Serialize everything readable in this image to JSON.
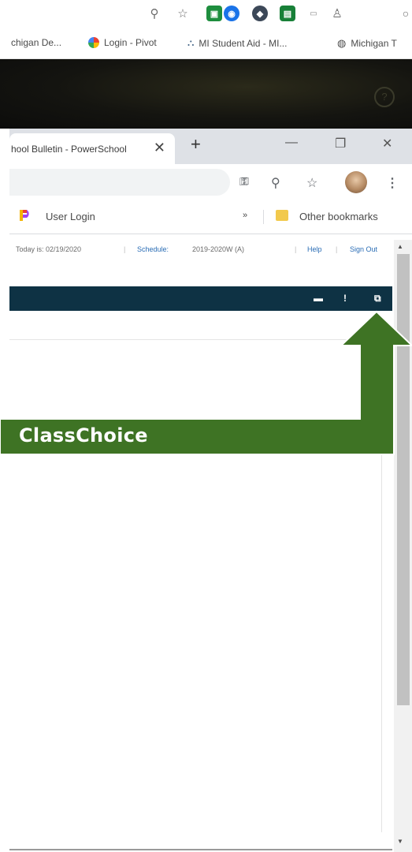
{
  "outer_bookmarks": [
    {
      "label": "chigan De..."
    },
    {
      "label": "Login - Pivot"
    },
    {
      "label": "MI Student Aid - MI..."
    },
    {
      "label": "Michigan T"
    }
  ],
  "tab": {
    "title": "hool Bulletin - PowerSchool",
    "close": "✕",
    "new_tab": "+"
  },
  "window_controls": {
    "minimize": "—",
    "restore": "❐",
    "close": "✕"
  },
  "inner_bookmarks": {
    "user_login": "User Login",
    "overflow": "»",
    "other": "Other bookmarks"
  },
  "powerschool": {
    "today": "Today is: 02/19/2020",
    "schedule_label": "Schedule:",
    "schedule_value": "2019-2020W (A)",
    "help": "Help",
    "sign_out": "Sign Out"
  },
  "annotation": {
    "label": "ClassChoice",
    "color": "#3e7324"
  },
  "icons": [
    "zoom-icon",
    "star-icon",
    "extension-icons",
    "key-icon",
    "print-icon",
    "alert-icon",
    "new-window-icon"
  ]
}
